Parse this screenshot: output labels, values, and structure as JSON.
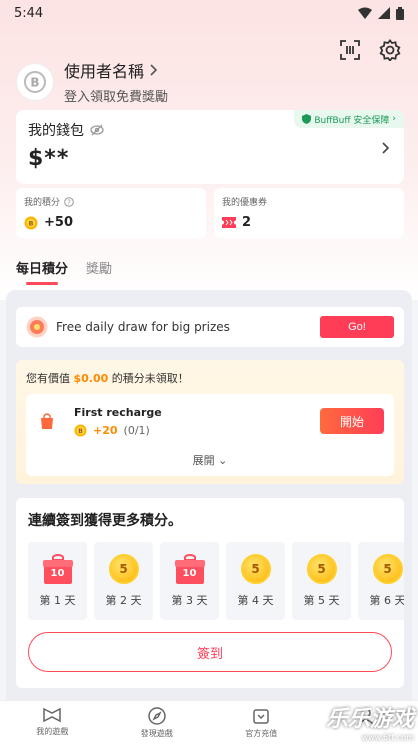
{
  "status_bar": {
    "time": "5:44"
  },
  "profile": {
    "username": "使用者名稱",
    "login_hint": "登入領取免費獎勵"
  },
  "wallet": {
    "title": "我的錢包",
    "amount": "$**",
    "safety_badge": "BuffBuff 安全保障"
  },
  "points": {
    "label": "我的積分",
    "value": "+50"
  },
  "coupons": {
    "label": "我的優惠券",
    "value": "2"
  },
  "tabs": [
    {
      "label": "每日積分",
      "active": true
    },
    {
      "label": "獎勵",
      "active": false
    }
  ],
  "draw": {
    "text": "Free daily draw for big prizes",
    "button": "Go!"
  },
  "recharge": {
    "unclaimed_prefix": "您有價值",
    "unclaimed_amount": "$0.00",
    "unclaimed_suffix": "的積分未領取！",
    "task_title": "First recharge",
    "reward_points": "+20",
    "progress": "(0/1)",
    "start_button": "開始",
    "expand_label": "展開"
  },
  "checkin": {
    "title": "連續簽到獲得更多積分。",
    "days": [
      {
        "label": "第 1 天",
        "reward_type": "gift",
        "amount": "10"
      },
      {
        "label": "第 2 天",
        "reward_type": "coin",
        "amount": "5"
      },
      {
        "label": "第 3 天",
        "reward_type": "gift",
        "amount": "10"
      },
      {
        "label": "第 4 天",
        "reward_type": "coin",
        "amount": "5"
      },
      {
        "label": "第 5 天",
        "reward_type": "coin",
        "amount": "5"
      },
      {
        "label": "第 6 天",
        "reward_type": "coin",
        "amount": "5"
      }
    ],
    "signin_button": "簽到"
  },
  "bottom_nav": [
    {
      "label": "我的遊戲",
      "icon": "gamepad-icon"
    },
    {
      "label": "發現遊戲",
      "icon": "compass-icon"
    },
    {
      "label": "官方充值",
      "icon": "wallet-icon"
    },
    {
      "label": "",
      "icon": "user-icon"
    }
  ],
  "watermark": {
    "title": "乐乐游戏",
    "url": "www.6tt.com"
  },
  "colors": {
    "accent": "#ff3d57",
    "coin": "#ffb400",
    "safety": "#1a9a55",
    "orange": "#ff8a00"
  }
}
